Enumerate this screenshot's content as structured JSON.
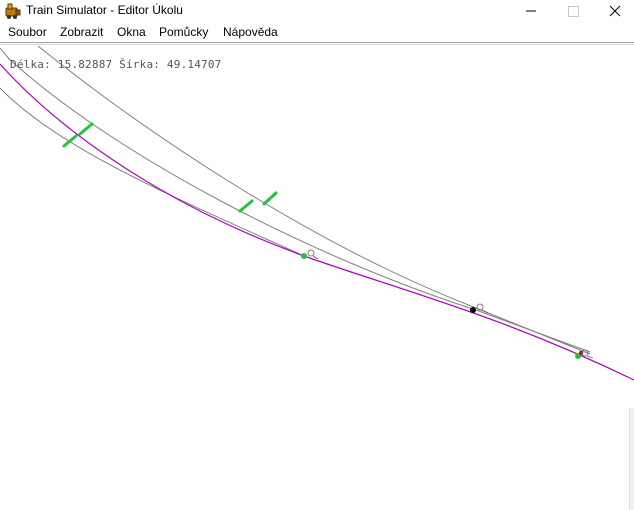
{
  "window": {
    "title": "Train Simulator - Editor Úkolu",
    "icon": "train-simulator-app-icon"
  },
  "menubar": {
    "items": [
      {
        "label": "Soubor"
      },
      {
        "label": "Zobrazit"
      },
      {
        "label": "Okna"
      },
      {
        "label": "Pomůcky"
      },
      {
        "label": "Nápověda"
      }
    ]
  },
  "canvas": {
    "coordinates": "Délka: 15.82887 Šírka: 49.14707"
  },
  "colors": {
    "track_line": "#808080",
    "route_line": "#b000c8",
    "signal_marker": "#22c43a",
    "node_black": "#000000",
    "signal_red": "#d01010"
  }
}
